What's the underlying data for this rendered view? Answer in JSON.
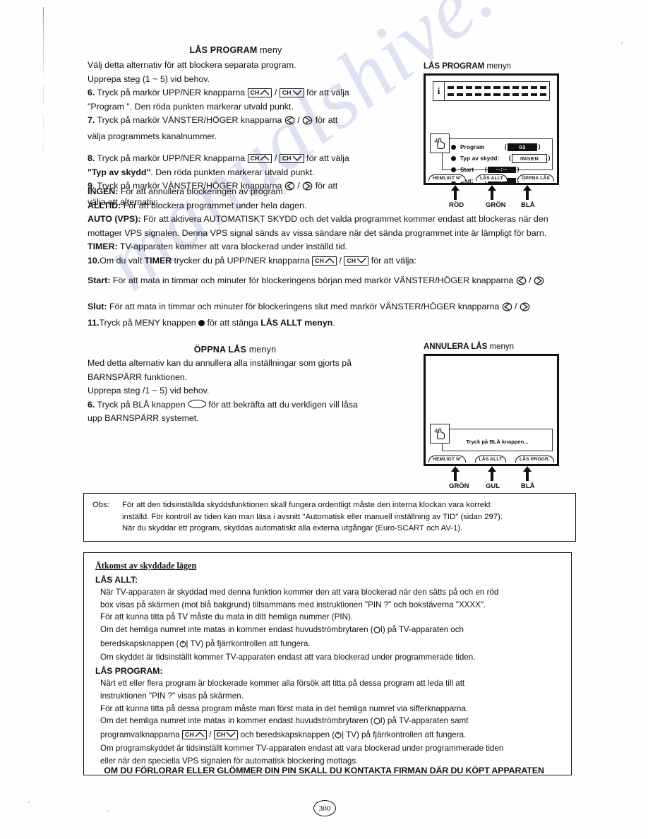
{
  "watermark": "manualshive.com",
  "page_number": "300",
  "section1": {
    "heading_bold": "LÅS PROGRAM",
    "heading_light": "meny",
    "lines": [
      "Välj detta alternativ för att blockera separata program.",
      "Upprepa steg (1 ~ 5) vid behov."
    ],
    "step6_num": "6.",
    "step6_a": "Tryck på markör UPP/NER knapparna",
    "step6_b": "för att välja",
    "step6_c": "\"Program \". Den röda punkten markerar utvald punkt.",
    "step7_num": "7.",
    "step7_a": "Tryck på markör VÄNSTER/HÖGER knapparna",
    "step7_b": "för att",
    "step7_c": "välja programmets kanalnummer.",
    "step8_num": "8.",
    "step8_a": "Tryck på markör UPP/NER knapparna",
    "step8_b": "för att välja",
    "step8_c_bold": "\"Typ av skydd\"",
    "step8_c_rest": ". Den röda punkten markerar utvald punkt.",
    "step9_num": "9.",
    "step9_a": "Tryck på markör VÄNSTER/HÖGER knapparna",
    "step9_b": "för att",
    "step9_c": "välja ett alternativ:",
    "opt_ingen_key": "INGEN:",
    "opt_ingen_txt": "För att annullera blockeringen av program.",
    "opt_alltid_key": "ALLTID:",
    "opt_alltid_txt": "För att blockera programmet under hela dagen.",
    "opt_auto_key": "AUTO (VPS):",
    "opt_auto_txt": "För att aktivera AUTOMATISKT SKYDD och det valda programmet kommer endast att blockeras när den mottager VPS signalen. Denna VPS signal sänds av vissa sändare när det sända programmet inte är lämpligt för barn.",
    "opt_timer_key": "TIMER:",
    "opt_timer_txt": "TV-apparaten kommer att vara blockerad under inställd tid.",
    "step10_num": "10.",
    "step10_a": "Om du valt",
    "step10_bold": "TIMER",
    "step10_b": "trycker du på UPP/NER knapparna",
    "step10_c": "för att välja:",
    "start_key": "Start:",
    "start_txt": "För att mata in timmar och minuter för blockeringens början med markör VÄNSTER/HÖGER knapparna",
    "slut_key": "Slut:",
    "slut_txt": "För att mata in timmar och minuter för blockeringens slut med markör VÄNSTER/HÖGER knapparna",
    "step11_num": "11.",
    "step11_a": "Tryck på MENY knappen",
    "step11_b": "för att stänga",
    "step11_bold": "LÅS ALLT menyn",
    "step11_end": "."
  },
  "section2": {
    "heading_bold": "ÖPPNA LÅS",
    "heading_light": "menyn",
    "lines": [
      "Med detta alternativ kan du annullera alla inställningar som gjorts på",
      "BARNSPÄRR funktionen.",
      "Upprepa steg /1 ~ 5) vid behov."
    ],
    "step6_num": "6.",
    "step6_a": "Tryck på BLÅ knappen",
    "step6_b": "för att bekräfta att du verkligen vill låsa",
    "step6_c": "upp BARNSPÄRR systemet."
  },
  "figure1": {
    "caption_bold": "LÅS PROGRAM",
    "caption_light": "menyn",
    "info_icon": "i",
    "rows": [
      {
        "label": "Program",
        "value": "03",
        "style": "dark"
      },
      {
        "label": "Typ av skydd:",
        "value": "INGEN",
        "style": "light"
      },
      {
        "label": "Start",
        "value": "--:--",
        "style": "dark"
      },
      {
        "label": "Slut:",
        "value": "--:--",
        "style": "dark"
      }
    ],
    "buttons": [
      "HEMLIGT N°",
      "LÅS ALLT",
      "ÖPPNA LÅS"
    ],
    "colors": [
      "RÖD",
      "GRÖN",
      "BLÅ"
    ]
  },
  "figure2": {
    "caption_bold": "ANNULERA LÅS",
    "caption_light": "menyn",
    "message": "Tryck på BLÅ knappen...",
    "buttons": [
      "HEMLIGT N°",
      "LÅS ALLT",
      "LÅS PROGR."
    ],
    "colors": [
      "GRÖN",
      "GUL",
      "BLÅ"
    ]
  },
  "obs_box": {
    "label": "Obs:",
    "line1": "För att den tidsinställda skyddsfunktionen skall fungera ordentligt måste den interna klockan vara korrekt",
    "line2": "inställd. För kontroll av tiden kan man läsa i avsnitt \"Automatisk eller manuell inställning av TID\" (sidan 297).",
    "line3": "När du skyddar ett program, skyddas automatiskt alla externa utgångar (Euro-SCART och AV-1)."
  },
  "access_box": {
    "title": "Åtkomst av skyddade lägen",
    "sub1": "LÅS ALLT:",
    "a1": "När TV-apparaten är skyddad med denna funktion kommer den att vara blockerad när den sätts på och en röd",
    "a2": "box visas på skärmen (mot blå bakgrund) tillsammans med instruktionen \"PIN ?\" och bokstäverna \"XXXX\".",
    "a3": "För att kunna titta på TV måste du mata in ditt hemliga nummer (PIN).",
    "a4_pre": "Om det hemliga numret inte matas in kommer endast huvudströmbrytaren (",
    "a4_mid": "I) på TV-apparaten och",
    "a5_pre": "beredskapsknappen (",
    "a5_mid": "| TV) på fjärrkontrollen att fungera.",
    "a6": "Om skyddet är tidsinställt kommer TV-apparaten endast att vara blockerad under programmerade tiden.",
    "sub2": "LÅS PROGRAM:",
    "b1": "Närt ett eller flera program är blockerade kommer alla försök att titta på dessa program att leda till att",
    "b2": "instruktionen \"PIN ?\" visas på skärmen.",
    "b3": "För att kunna titta på dessa program måste man först mata in det hemliga numret via sifferknapparna.",
    "b4_pre": "Om det hemliga numret inte matas in kommer endast huvudströmbrytaren (",
    "b4_mid": "I) på TV-apparaten samt",
    "b5_pre": "programvalknapparna",
    "b5_mid": "och beredskapsknappen (",
    "b5_post": "| TV) på fjärrkontrollen att fungera.",
    "b6": "Om programskyddet är tidsinställt kommer TV-apparaten endast att vara blockerad under programmerade tiden",
    "b7": "eller när den speciella VPS signalen för automatisk blockering mottags."
  },
  "footer": "OM DU FÖRLORAR ELLER GLÖMMER DIN PIN SKALL DU KONTAKTA FIRMAN DÄR DU KÖPT APPARATEN"
}
